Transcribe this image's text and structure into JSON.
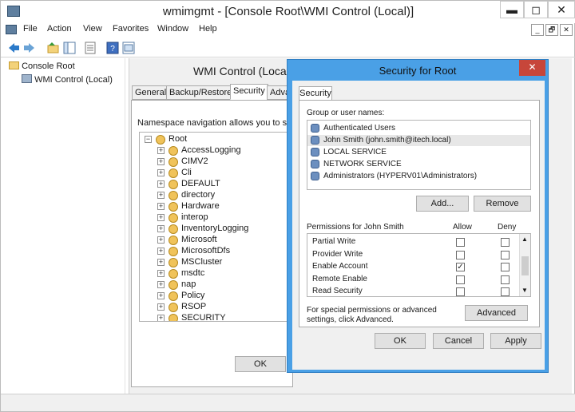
{
  "window": {
    "title": "wmimgmt - [Console Root\\WMI Control (Local)]",
    "minimize_glyph": "▬",
    "maximize_glyph": "◻",
    "close_glyph": "✕"
  },
  "menubar": {
    "items": [
      "File",
      "Action",
      "View",
      "Favorites",
      "Window",
      "Help"
    ],
    "mdi_minimize": "_",
    "mdi_restore": "🗗",
    "mdi_close": "✕"
  },
  "toolbar": {
    "icons": [
      "back-arrow-icon",
      "forward-arrow-icon",
      "up-folder-icon",
      "show-tree-icon",
      "properties-icon",
      "help-icon",
      "console-tree-icon"
    ]
  },
  "tree": {
    "root": "Console Root",
    "child": "WMI Control (Local)"
  },
  "wmi_dialog": {
    "title": "WMI Control (Local)",
    "tabs": [
      "General",
      "Backup/Restore",
      "Security",
      "Adva"
    ],
    "description": "Namespace navigation allows you to set nam",
    "namespace_root": "Root",
    "namespaces": [
      "AccessLogging",
      "CIMV2",
      "Cli",
      "DEFAULT",
      "directory",
      "Hardware",
      "interop",
      "InventoryLogging",
      "Microsoft",
      "MicrosoftDfs",
      "MSCluster",
      "msdtc",
      "nap",
      "Policy",
      "RSOP",
      "SECURITY"
    ],
    "ok_label": "OK"
  },
  "security_dialog": {
    "title": "Security for Root",
    "close_glyph": "✕",
    "tab_label": "Security",
    "group_label": "Group or user names:",
    "users": [
      {
        "name": "Authenticated Users",
        "selected": false
      },
      {
        "name": "John Smith (john.smith@itech.local)",
        "selected": true
      },
      {
        "name": "LOCAL SERVICE",
        "selected": false
      },
      {
        "name": "NETWORK SERVICE",
        "selected": false
      },
      {
        "name": "Administrators (HYPERV01\\Administrators)",
        "selected": false
      }
    ],
    "add_label": "Add...",
    "remove_label": "Remove",
    "permissions_label": "Permissions for John Smith",
    "allow_label": "Allow",
    "deny_label": "Deny",
    "permissions": [
      {
        "name": "Partial Write",
        "allow": false,
        "deny": false
      },
      {
        "name": "Provider Write",
        "allow": false,
        "deny": false
      },
      {
        "name": "Enable Account",
        "allow": true,
        "deny": false
      },
      {
        "name": "Remote Enable",
        "allow": false,
        "deny": false
      },
      {
        "name": "Read Security",
        "allow": false,
        "deny": false
      }
    ],
    "special_text": "For special permissions or advanced settings, click Advanced.",
    "advanced_label": "Advanced",
    "ok_label": "OK",
    "cancel_label": "Cancel",
    "apply_label": "Apply",
    "check_glyph": "✓"
  },
  "colors": {
    "dialog_border": "#4aa0e6",
    "close_red": "#c7463a",
    "folder_yellow": "#f3d27a"
  }
}
